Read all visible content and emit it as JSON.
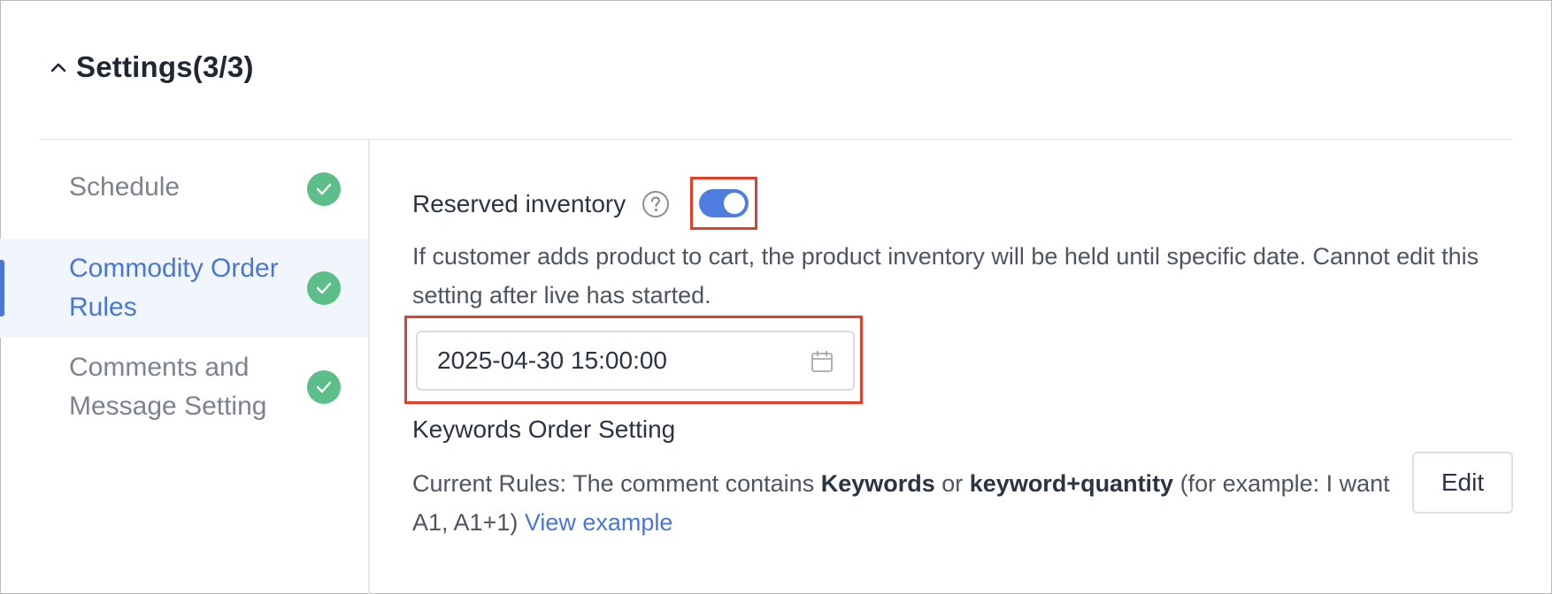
{
  "header": {
    "title": "Settings(3/3)",
    "collapse_icon": "chevron-up-icon"
  },
  "sidebar": {
    "items": [
      {
        "label": "Schedule",
        "status_icon": "check-circle-icon",
        "active": false
      },
      {
        "label": "Commodity Order Rules",
        "status_icon": "check-circle-icon",
        "active": true
      },
      {
        "label": "Comments and Message Setting",
        "status_icon": "check-circle-icon",
        "active": false
      }
    ]
  },
  "reserved_inventory": {
    "label": "Reserved inventory",
    "help_icon": "question-circle-icon",
    "toggle_on": true,
    "description": "If customer adds product to cart, the product inventory will be held until specific date. Cannot edit this setting after live has started.",
    "date_value": "2025-04-30 15:00:00",
    "calendar_icon": "calendar-icon"
  },
  "keywords": {
    "title": "Keywords Order Setting",
    "rules_prefix": "Current Rules: The comment contains ",
    "rules_keyword1": "Keywords",
    "rules_or": " or ",
    "rules_keyword2": "keyword+quantity",
    "rules_suffix": " (for example: I want A1, A1+1) ",
    "view_example": "View example",
    "edit_label": "Edit"
  },
  "colors": {
    "accent": "#4a77d6",
    "success": "#5cbf8a",
    "highlight_border": "#e0402a"
  }
}
